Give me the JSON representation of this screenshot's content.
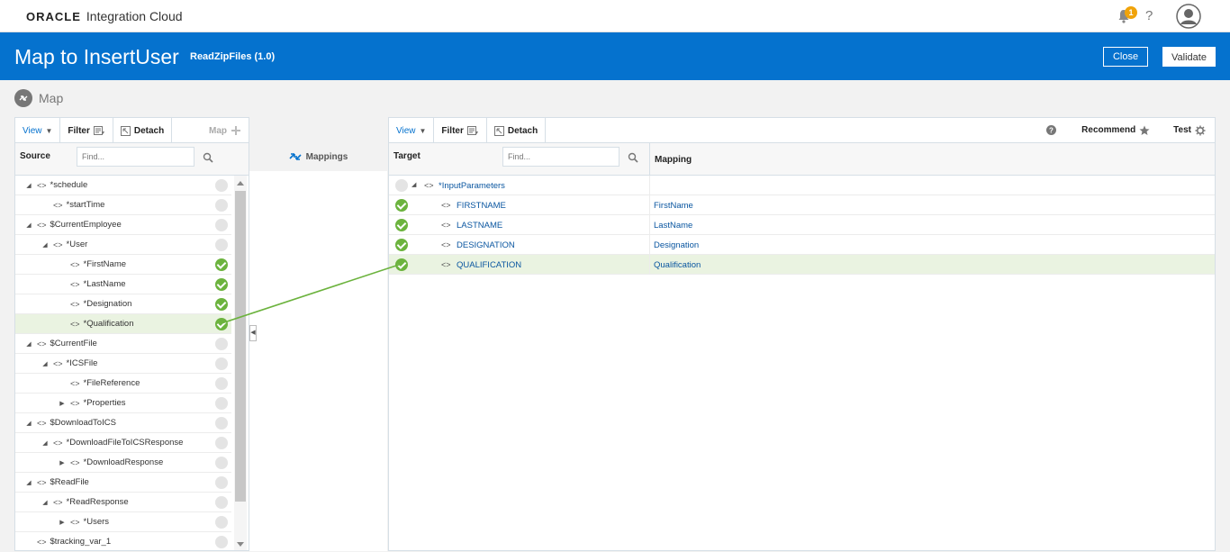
{
  "topbar": {
    "brand_oracle": "ORACLE",
    "brand_product": "Integration Cloud",
    "notification_count": "1",
    "help_label": "?"
  },
  "header": {
    "title": "Map to InsertUser",
    "subtitle": "ReadZipFiles (1.0)",
    "close_label": "Close",
    "validate_label": "Validate"
  },
  "section_title": "Map",
  "source": {
    "toolbar": {
      "view": "View",
      "filter": "Filter",
      "detach": "Detach",
      "map": "Map"
    },
    "header_label": "Source",
    "find_placeholder": "Find...",
    "rows": [
      {
        "label": "*schedule",
        "status": "none"
      },
      {
        "label": "*startTime",
        "status": "none"
      },
      {
        "label": "$CurrentEmployee",
        "status": "none"
      },
      {
        "label": "*User",
        "status": "none"
      },
      {
        "label": "*FirstName",
        "status": "ok"
      },
      {
        "label": "*LastName",
        "status": "ok"
      },
      {
        "label": "*Designation",
        "status": "ok"
      },
      {
        "label": "*Qualification",
        "status": "ok"
      },
      {
        "label": "$CurrentFile",
        "status": "none"
      },
      {
        "label": "*ICSFile",
        "status": "none"
      },
      {
        "label": "*FileReference",
        "status": "none"
      },
      {
        "label": "*Properties",
        "status": "none"
      },
      {
        "label": "$DownloadToICS",
        "status": "none"
      },
      {
        "label": "*DownloadFileToICSResponse",
        "status": "none"
      },
      {
        "label": "*DownloadResponse",
        "status": "none"
      },
      {
        "label": "$ReadFile",
        "status": "none"
      },
      {
        "label": "*ReadResponse",
        "status": "none"
      },
      {
        "label": "*Users",
        "status": "none"
      },
      {
        "label": "$tracking_var_1",
        "status": "none"
      }
    ]
  },
  "mappings_label": "Mappings",
  "target": {
    "toolbar": {
      "view": "View",
      "filter": "Filter",
      "detach": "Detach",
      "recommend": "Recommend",
      "test": "Test"
    },
    "header_label": "Target",
    "mapping_label": "Mapping",
    "find_placeholder": "Find...",
    "rows": [
      {
        "label": "*InputParameters",
        "mapping": "",
        "status": "none"
      },
      {
        "label": "FIRSTNAME",
        "mapping": "FirstName",
        "status": "ok"
      },
      {
        "label": "LASTNAME",
        "mapping": "LastName",
        "status": "ok"
      },
      {
        "label": "DESIGNATION",
        "mapping": "Designation",
        "status": "ok"
      },
      {
        "label": "QUALIFICATION",
        "mapping": "Qualification",
        "status": "ok"
      }
    ]
  },
  "colors": {
    "brand_blue": "#0572ce",
    "mapped_green": "#6cb33e",
    "selected_row": "#eaf3e1"
  }
}
